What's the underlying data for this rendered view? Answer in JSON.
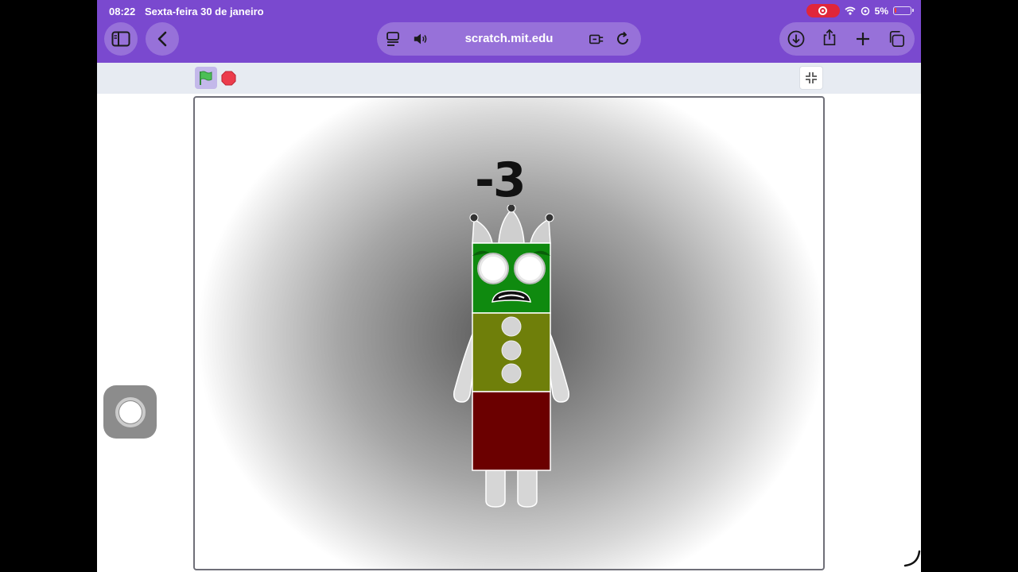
{
  "status_bar": {
    "time": "08:22",
    "date": "Sexta-feira 30 de janeiro",
    "battery": "5%"
  },
  "browser": {
    "url": "scratch.mit.edu"
  },
  "stage": {
    "sprite_label": "-3"
  },
  "colors": {
    "browser_chrome": "#7a49cf",
    "sprite_head": "#0f8a0f",
    "sprite_torso": "#6f7f0a",
    "sprite_legs": "#6b0000",
    "flag_green": "#4cbf56",
    "stop_red": "#ec3c4c"
  }
}
